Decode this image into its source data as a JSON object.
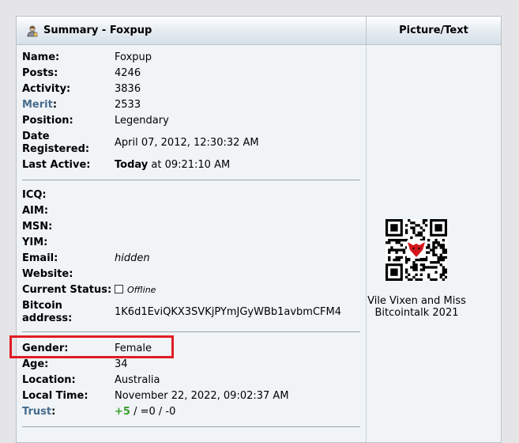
{
  "header": {
    "summary_title": "Summary - Foxpup",
    "picture_title": "Picture/Text"
  },
  "fields": {
    "name": {
      "label": "Name:",
      "value": "Foxpup"
    },
    "posts": {
      "label": "Posts:",
      "value": "4246"
    },
    "activity": {
      "label": "Activity:",
      "value": "3836"
    },
    "merit": {
      "label": "Merit",
      "colon": ":",
      "value": "2533"
    },
    "position": {
      "label": "Position:",
      "value": "Legendary"
    },
    "date_registered": {
      "label_line1": "Date",
      "label_line2": "Registered:",
      "value": "April 07, 2012, 12:30:32 AM"
    },
    "last_active": {
      "label": "Last Active:",
      "value_bold": "Today",
      "value_rest": " at 09:21:10 AM"
    },
    "icq": {
      "label": "ICQ:"
    },
    "aim": {
      "label": "AIM:"
    },
    "msn": {
      "label": "MSN:"
    },
    "yim": {
      "label": "YIM:"
    },
    "email": {
      "label": "Email:",
      "value": "hidden"
    },
    "website": {
      "label": "Website:"
    },
    "current_status": {
      "label": "Current Status:",
      "value": "Offline"
    },
    "bitcoin": {
      "label_line1": "Bitcoin",
      "label_line2": "address:",
      "value": "1K6d1EviQKX3SVKjPYmJGyWBb1avbmCFM4"
    },
    "gender": {
      "label": "Gender:",
      "value": "Female"
    },
    "age": {
      "label": "Age:",
      "value": "34"
    },
    "location": {
      "label": "Location:",
      "value": "Australia"
    },
    "local_time": {
      "label": "Local Time:",
      "value": "November 22, 2022, 09:02:37 AM"
    },
    "trust": {
      "label": "Trust",
      "colon": ":",
      "positive": "+5",
      "rest": " / =0 / -0"
    }
  },
  "picture_text": {
    "caption_line1": "Vile Vixen and Miss",
    "caption_line2": "Bitcointalk 2021"
  },
  "colors": {
    "link": "#476c8e",
    "highlight": "#e11c24",
    "trust_positive": "#3c9d2f"
  },
  "icons": [
    "user-icon",
    "qr-code-avatar",
    "offline-checkbox-icon"
  ]
}
